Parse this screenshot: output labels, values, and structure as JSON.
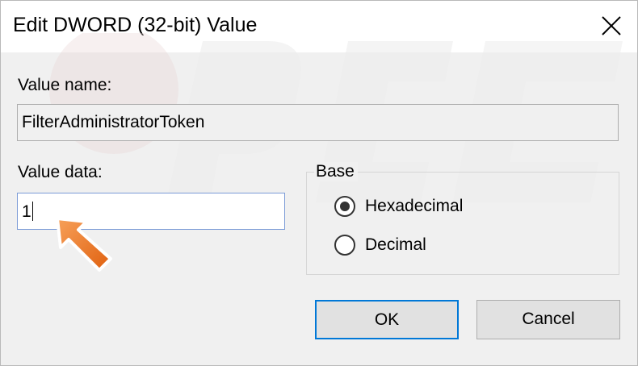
{
  "window": {
    "title": "Edit DWORD (32-bit) Value",
    "close_icon": "close-icon"
  },
  "fields": {
    "value_name_label": "Value name:",
    "value_name": "FilterAdministratorToken",
    "value_data_label": "Value data:",
    "value_data": "1"
  },
  "base": {
    "legend": "Base",
    "options": [
      {
        "label": "Hexadecimal",
        "selected": true
      },
      {
        "label": "Decimal",
        "selected": false
      }
    ]
  },
  "buttons": {
    "ok": "OK",
    "cancel": "Cancel"
  },
  "overlay": {
    "pointer_icon": "arrow-pointer-icon",
    "pointer_color": "#f07a22"
  },
  "colors": {
    "focus_border": "#0078d7",
    "input_border": "#7a9ad6",
    "dialog_bg": "#f0f0f0"
  }
}
